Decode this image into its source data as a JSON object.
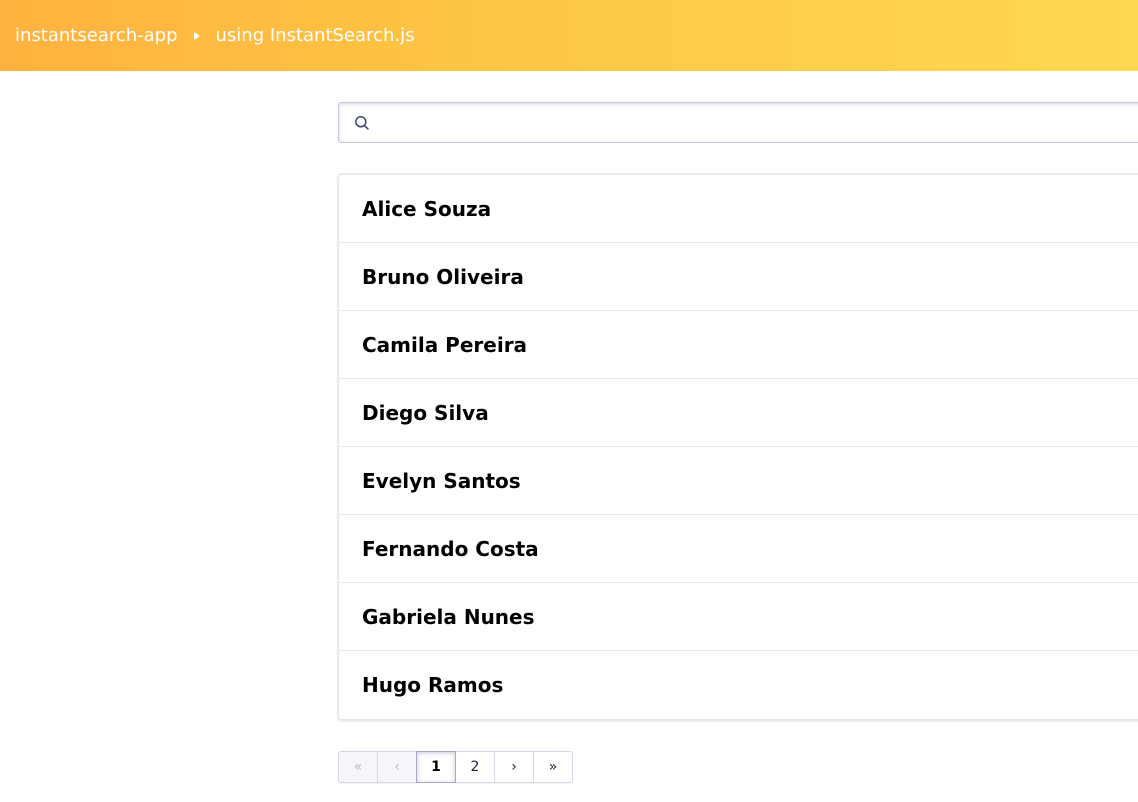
{
  "header": {
    "app_name": "instantsearch-app",
    "subtitle": "using InstantSearch.js",
    "gradient_start": "#ffb23f",
    "gradient_end": "#ffd84f"
  },
  "search": {
    "value": "",
    "placeholder": "",
    "icon": "search-icon"
  },
  "hits": [
    {
      "name": "Alice Souza"
    },
    {
      "name": "Bruno Oliveira"
    },
    {
      "name": "Camila Pereira"
    },
    {
      "name": "Diego Silva"
    },
    {
      "name": "Evelyn Santos"
    },
    {
      "name": "Fernando Costa"
    },
    {
      "name": "Gabriela Nunes"
    },
    {
      "name": "Hugo Ramos"
    }
  ],
  "pagination": {
    "first": "«",
    "previous": "‹",
    "pages": [
      "1",
      "2"
    ],
    "current_page": "1",
    "next": "›",
    "last": "»"
  }
}
